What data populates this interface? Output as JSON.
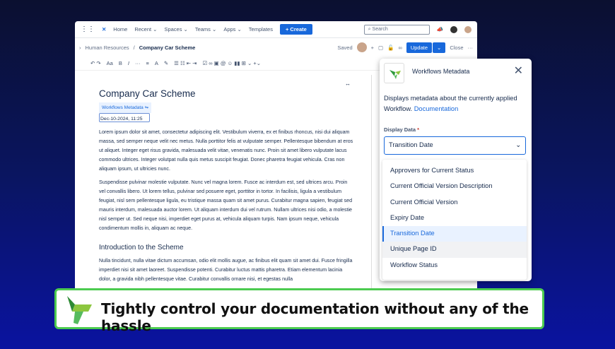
{
  "nav": {
    "items": [
      "Home",
      "Recent ⌄",
      "Spaces ⌄",
      "Teams ⌄",
      "Apps ⌄",
      "Templates"
    ],
    "create": "+ Create",
    "search_placeholder": "Search"
  },
  "breadcrumb": {
    "parent": "Human Resources",
    "current": "Company Car Scheme",
    "status": "Saved",
    "update": "Update",
    "close": "Close"
  },
  "toolbar": {
    "text_style": "Aa"
  },
  "page": {
    "title": "Company Car Scheme",
    "macro_chip": "Workflows Metadata",
    "macro_value": "Dec-10-2024, 11:25",
    "paragraphs": [
      "Lorem ipsum dolor sit amet, consectetur adipiscing elit. Vestibulum viverra, ex et finibus rhoncus, nisi dui aliquam massa, sed semper neque velit nec metus. Nulla porttitor felis at vulputate semper. Pellentesque bibendum at eros ut aliquet. Integer eget risus gravida, malesuada velit vitae, venenatis nunc. Proin sit amet libero vulputate lacus commodo ultrices. Integer volutpat nulla quis metus suscipit feugiat. Donec pharetra feugiat vehicula. Cras non aliquam ipsum, ut ultricies nunc.",
      "Suspendisse pulvinar molestie vulputate. Nunc vel magna lorem. Fusce ac interdum est, sed ultrices arcu. Proin vel convallis libero. Ut lorem tellus, pulvinar sed posuere eget, porttitor in tortor. In facilisis, ligula a vestibulum feugiat, nisl sem pellentesque ligula, eu tristique massa quam sit amet purus. Curabitur magna sapien, feugiat sed mauris interdum, malesuada auctor lorem. Ut aliquam interdum dui vel rutrum. Nullam ultrices nisi odio, a molestie nisl semper ut. Sed neque nisi, imperdiet eget purus at, vehicula aliquam turpis. Nam ipsum neque, vehicula condimentum mollis in, aliquam ac neque."
    ],
    "heading2": "Introduction to the Scheme",
    "paragraph3": "Nulla tincidunt, nulla vitae dictum accumsan, odio elit mollis augue, ac finibus elit quam sit amet dui. Fusce fringilla imperdiet nisi sit amet laoreet. Suspendisse potenti. Curabitur luctus mattis pharetra. Etiam elementum lacinia dolor, a gravida nibh pellentesque vitae. Curabitur convallis ornare nisi, et egestas nulla"
  },
  "panel": {
    "title": "Workflows Metadata",
    "description": "Displays metadata about the currently applied Workflow.",
    "doc_link": "Documentation",
    "field_label": "Display Data",
    "required": "*",
    "selected": "Transition Date",
    "options": [
      "Approvers for Current Status",
      "Current Official Version Description",
      "Current Official Version",
      "Expiry Date",
      "Transition Date",
      "Unique Page ID",
      "Workflow Status"
    ]
  },
  "banner": {
    "text": "Tightly control your documentation without any of the hassle"
  },
  "colors": {
    "accent": "#1868db",
    "banner_border": "#4ccb4f"
  }
}
